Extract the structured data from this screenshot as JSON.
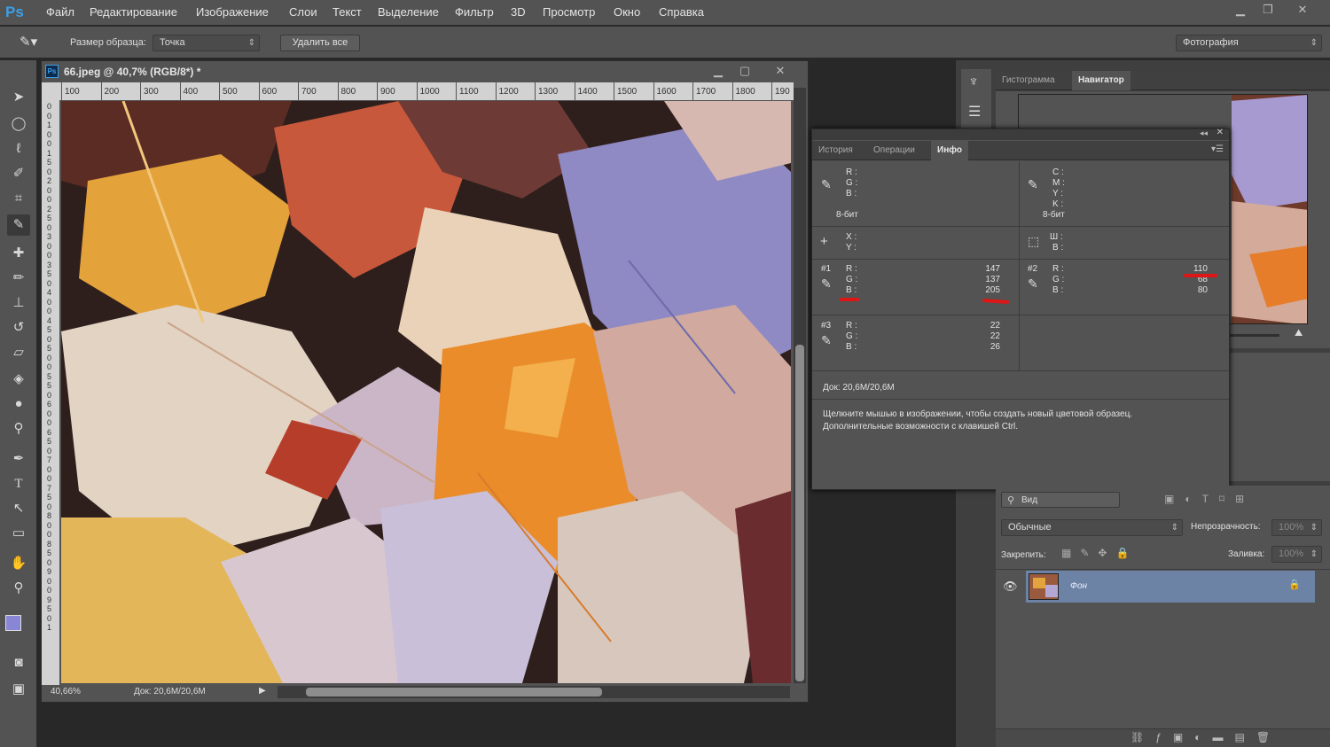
{
  "app": {
    "logo": "Ps"
  },
  "menu": [
    "Файл",
    "Редактирование",
    "Изображение",
    "Слои",
    "Текст",
    "Выделение",
    "Фильтр",
    "3D",
    "Просмотр",
    "Окно",
    "Справка"
  ],
  "options": {
    "sample_size_label": "Размер образца:",
    "sample_size_value": "Точка",
    "delete_all": "Удалить все",
    "workspace": "Фотография"
  },
  "document": {
    "title": "66.jpeg @ 40,7% (RGB/8*) *",
    "zoom": "40,66%",
    "doc_size": "Док: 20,6М/20,6М",
    "ruler_h": [
      "100",
      "200",
      "300",
      "400",
      "500",
      "600",
      "700",
      "800",
      "900",
      "1000",
      "1100",
      "1200",
      "1300",
      "1400",
      "1500",
      "1600",
      "1700",
      "1800",
      "190"
    ],
    "ruler_v": [
      "0",
      "0",
      "1",
      "0",
      "0",
      "1",
      "5",
      "0",
      "2",
      "0",
      "0",
      "2",
      "5",
      "0",
      "3",
      "0",
      "0",
      "3",
      "5",
      "0",
      "4",
      "0",
      "0",
      "4",
      "5",
      "0",
      "5",
      "0",
      "0",
      "5",
      "5",
      "0",
      "6",
      "0",
      "0",
      "6",
      "5",
      "0",
      "7",
      "0",
      "0",
      "7",
      "5",
      "0",
      "8",
      "0",
      "0",
      "8",
      "5",
      "0",
      "9",
      "0",
      "0",
      "9",
      "5",
      "0",
      "1"
    ]
  },
  "panels": {
    "top_tabs": [
      "Гистограмма",
      "Навигатор"
    ],
    "info_tabs": [
      "История",
      "Операции",
      "Инфо"
    ],
    "info": {
      "rgb": [
        "R :",
        "G :",
        "B :"
      ],
      "cmyk": [
        "C :",
        "M :",
        "Y :",
        "K :"
      ],
      "bit1": "8-бит",
      "bit2": "8-бит",
      "xy": [
        "X :",
        "Y :"
      ],
      "wh": [
        "Ш :",
        "В :"
      ],
      "s1": {
        "label": "#1",
        "R": "147",
        "G": "137",
        "B": "205"
      },
      "s2": {
        "label": "#2",
        "R": "110",
        "G": "68",
        "B": "80"
      },
      "s3": {
        "label": "#3",
        "R": "22",
        "G": "22",
        "B": "26"
      },
      "doc": "Док: 20,6М/20,6М",
      "hint1": "Щелкните мышью в изображении, чтобы создать новый цветовой образец.",
      "hint2": "Дополнительные возможности с клавишей Ctrl."
    },
    "layers": {
      "search": "Вид",
      "blend": "Обычные",
      "opacity_label": "Непрозрачность:",
      "opacity": "100%",
      "lock_label": "Закрепить:",
      "fill_label": "Заливка:",
      "fill": "100%",
      "layer_name": "Фон"
    }
  }
}
